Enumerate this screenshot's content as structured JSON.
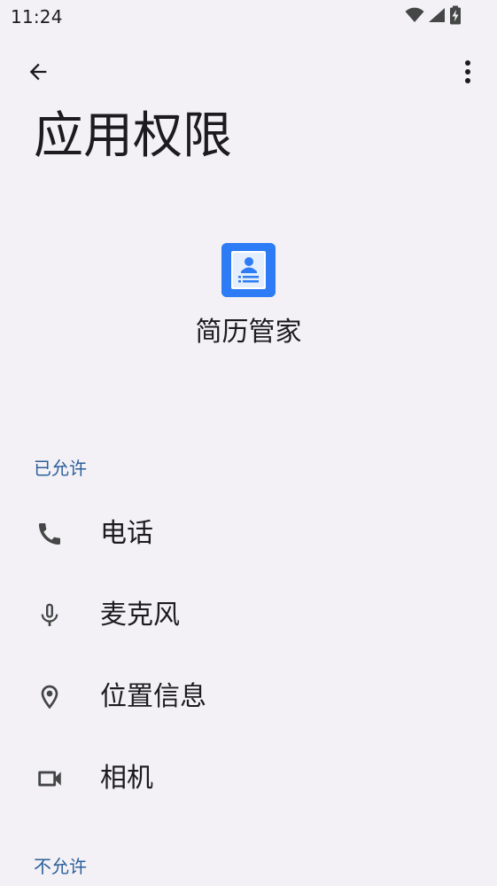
{
  "status_bar": {
    "time": "11:24",
    "icons": [
      "wifi-icon",
      "cellular-signal-icon",
      "battery-charging-icon"
    ]
  },
  "app_bar": {
    "back_icon": "arrow-back-icon",
    "more_icon": "more-vert-icon"
  },
  "page": {
    "title": "应用权限"
  },
  "app": {
    "name": "简历管家",
    "icon": "resume-contact-book-icon",
    "icon_color": "#2d7cf6"
  },
  "sections": {
    "allowed": {
      "header": "已允许",
      "items": [
        {
          "label": "电话",
          "icon": "phone-icon"
        },
        {
          "label": "麦克风",
          "icon": "microphone-icon"
        },
        {
          "label": "位置信息",
          "icon": "location-pin-icon"
        },
        {
          "label": "相机",
          "icon": "video-camera-icon"
        }
      ]
    },
    "denied": {
      "header": "不允许"
    }
  },
  "colors": {
    "background": "#f3f1f6",
    "section_header": "#2c5f9b",
    "text_primary": "#1c1b1f",
    "icon": "#444746"
  }
}
